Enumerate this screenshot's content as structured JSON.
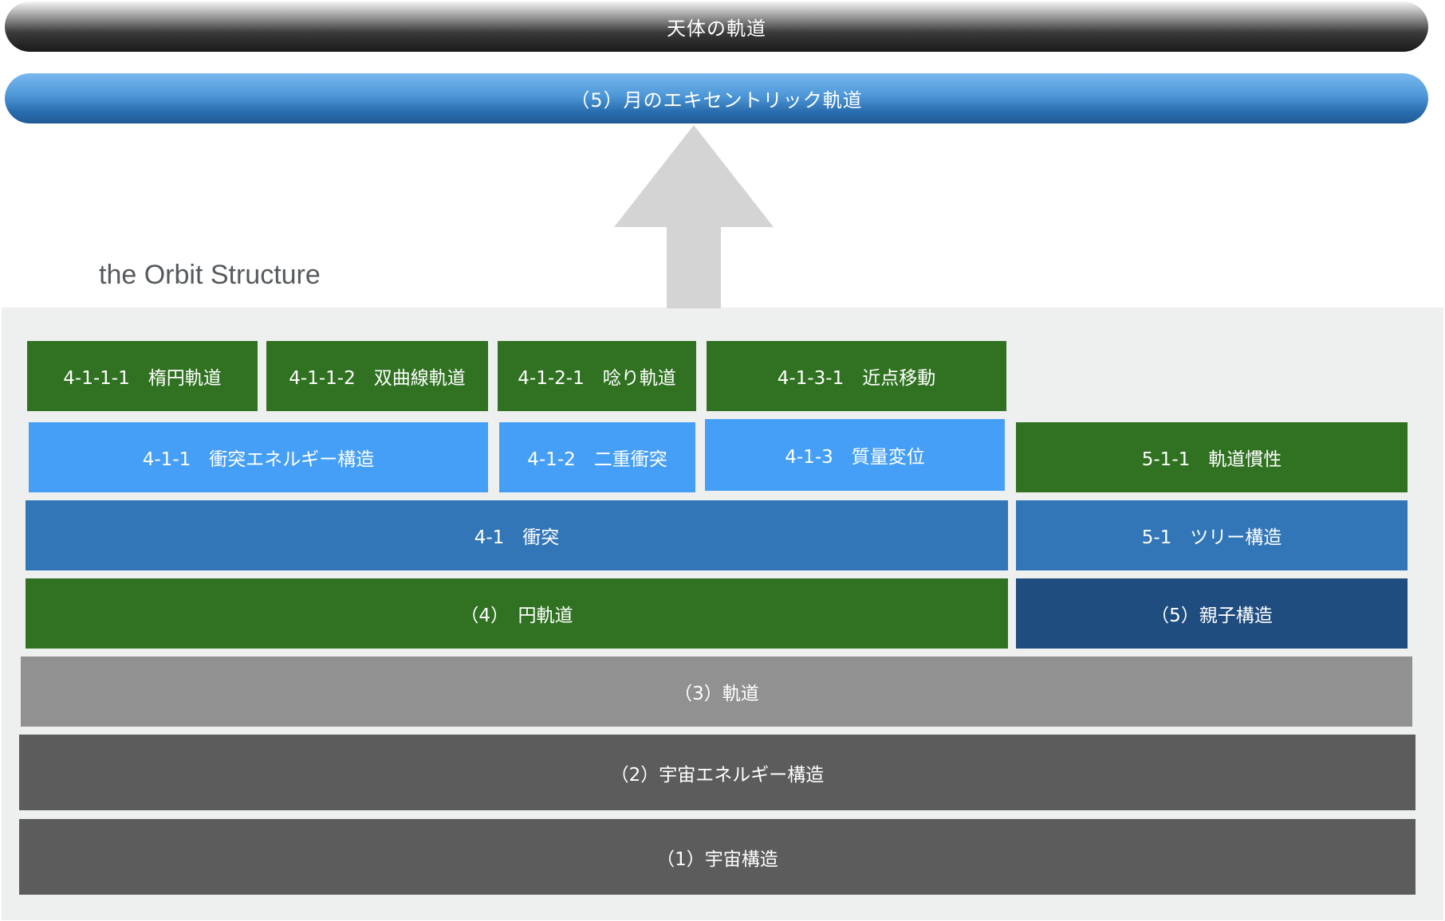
{
  "header": {
    "top_pill": "天体の軌道",
    "second_pill": "（5）月のエキセントリック軌道"
  },
  "diagram": {
    "title": "the Orbit Structure",
    "row_level4": {
      "b1": "4-1-1-1　楕円軌道",
      "b2": "4-1-1-2　双曲線軌道",
      "b3": "4-1-2-1　唸り軌道",
      "b4": "4-1-3-1　近点移動"
    },
    "row_level3": {
      "b1": "4-1-1　衝突エネルギー構造",
      "b2": "4-1-2　二重衝突",
      "b3": "4-1-3　質量変位",
      "b4": "5-1-1　軌道慣性"
    },
    "row_level2": {
      "b1": "4-1　衝突",
      "b2": "5-1　ツリー構造"
    },
    "row_level1": {
      "b1": "（4）　円軌道",
      "b2": "（5）親子構造"
    },
    "base": {
      "l3": "（3）軌道",
      "l2": "（2）宇宙エネルギー構造",
      "l1": "（1）宇宙構造"
    }
  },
  "colors": {
    "green": "#307222",
    "light_blue": "#469ff6",
    "mid_blue": "#3276b8",
    "navy": "#1f4d80",
    "grey": "#919191",
    "dark_grey": "#5c5c5c",
    "arrow": "#d4d4d4"
  }
}
